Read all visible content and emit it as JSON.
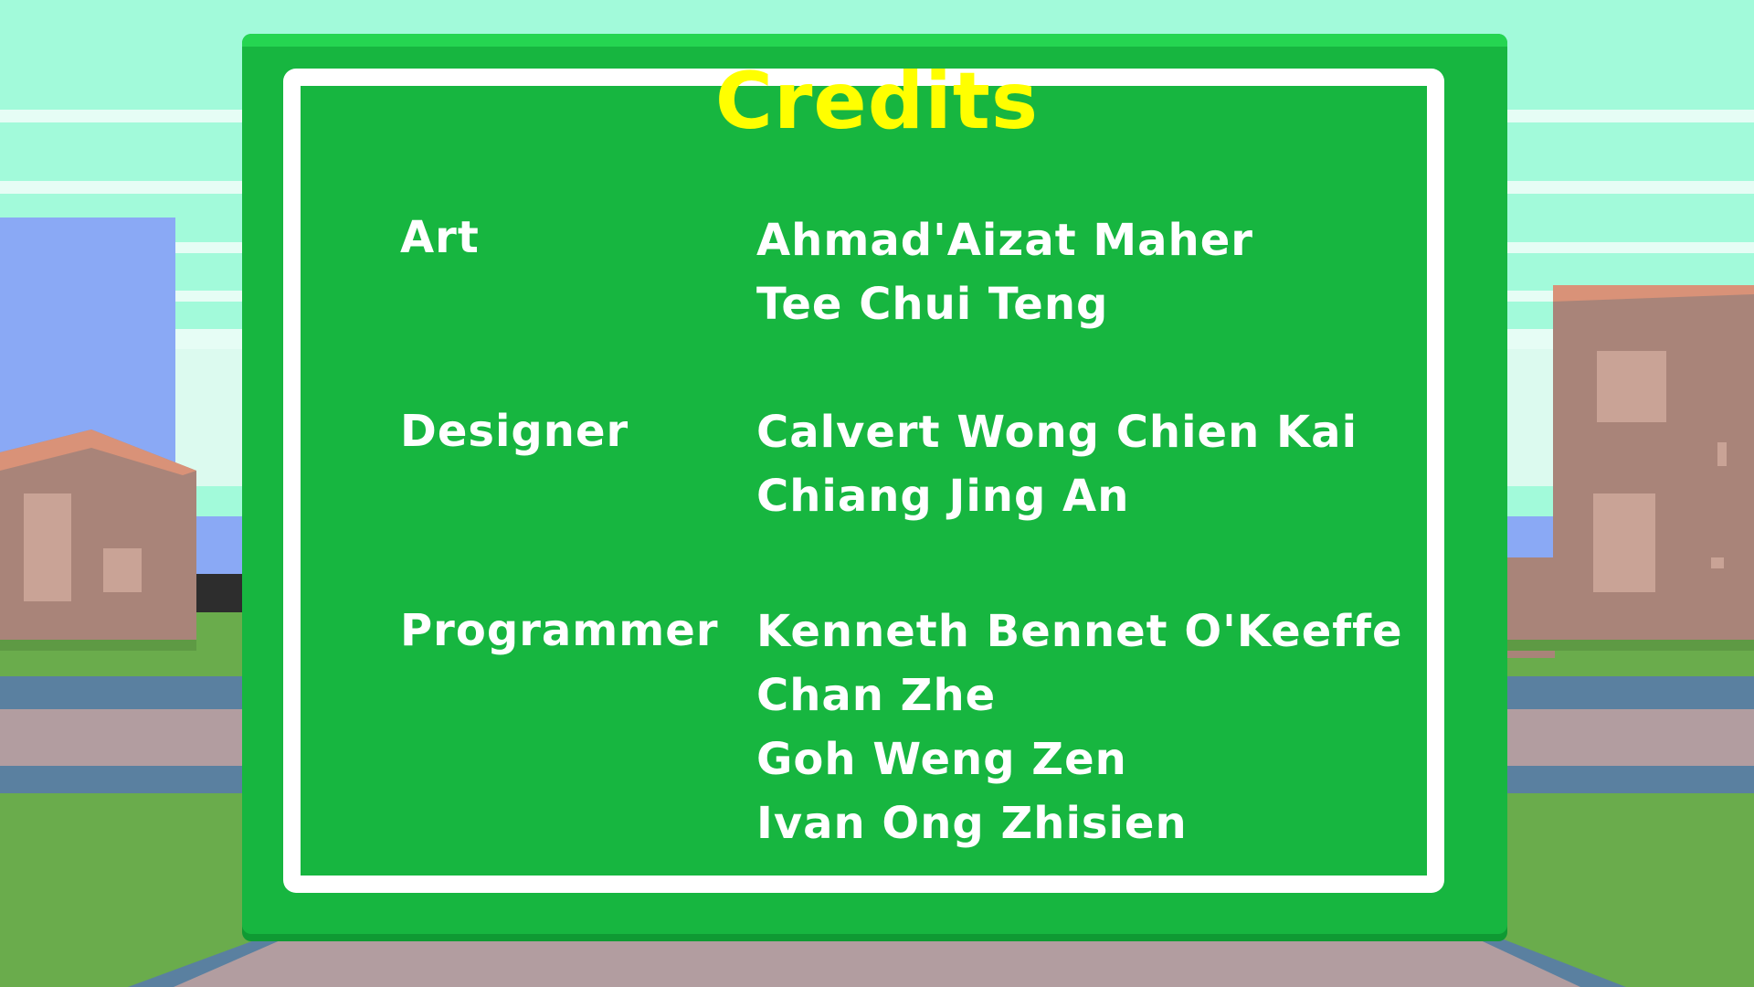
{
  "title": "Credits",
  "sections": [
    {
      "role": "Art",
      "names": [
        "Ahmad'Aizat Maher",
        "Tee Chui Teng"
      ]
    },
    {
      "role": "Designer",
      "names": [
        "Calvert Wong Chien Kai",
        "Chiang Jing An"
      ]
    },
    {
      "role": "Programmer",
      "names": [
        "Kenneth Bennet O'Keeffe",
        "Chan Zhe",
        "Goh Weng Zen",
        "Ivan Ong Zhisien"
      ]
    }
  ],
  "colors": {
    "sky": "#a2fada",
    "board_green": "#17b640",
    "board_frame": "#ffffff",
    "title": "#ffff00",
    "text": "#ffffff",
    "grass": "#6aac4c",
    "road": "#b29da0",
    "road_edge": "#5a80a0"
  }
}
